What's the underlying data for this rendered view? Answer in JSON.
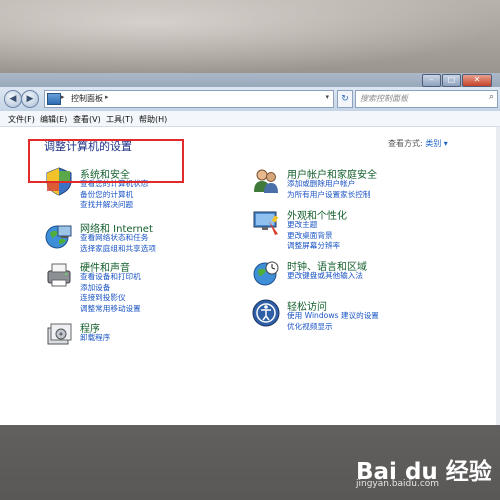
{
  "window": {
    "address": "控制面板",
    "search_placeholder": "搜索控制面板"
  },
  "menu": [
    "文件(F)",
    "编辑(E)",
    "查看(V)",
    "工具(T)",
    "帮助(H)"
  ],
  "heading": "调整计算机的设置",
  "view_by": {
    "label": "查看方式:",
    "value": "类别"
  },
  "categories_left": [
    {
      "title": "系统和安全",
      "links": [
        "查看您的计算机状态",
        "备份您的计算机",
        "查找并解决问题"
      ]
    },
    {
      "title": "网络和 Internet",
      "links": [
        "查看网络状态和任务",
        "选择家庭组和共享选项"
      ]
    },
    {
      "title": "硬件和声音",
      "links": [
        "查看设备和打印机",
        "添加设备",
        "连接到投影仪",
        "调整常用移动设置"
      ]
    },
    {
      "title": "程序",
      "links": [
        "卸载程序"
      ]
    }
  ],
  "categories_right": [
    {
      "title": "用户帐户和家庭安全",
      "links": [
        "添加或删除用户帐户",
        "为所有用户设置家长控制"
      ]
    },
    {
      "title": "外观和个性化",
      "links": [
        "更改主题",
        "更改桌面背景",
        "调整屏幕分辨率"
      ]
    },
    {
      "title": "时钟、语言和区域",
      "links": [
        "更改键盘或其他输入法"
      ]
    },
    {
      "title": "轻松访问",
      "links": [
        "使用 Windows 建议的设置",
        "优化视频显示"
      ]
    }
  ],
  "watermark": {
    "logo": "Bai du 经验",
    "url": "jingyan.baidu.com"
  }
}
